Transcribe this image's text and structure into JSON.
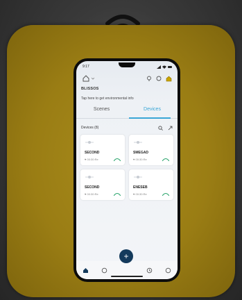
{
  "status_bar": {
    "time": "9:17"
  },
  "header": {
    "home_name": "BLISSOS",
    "env_hint": "Tap here to get environmental info"
  },
  "tabs": [
    {
      "label": "Scenes",
      "active": false
    },
    {
      "label": "Devices",
      "active": true
    }
  ],
  "devices_section": {
    "label": "Devices (8)"
  },
  "cards": [
    {
      "name": "SECOND",
      "sub": "♥ 00:30:Re"
    },
    {
      "name": "SMEGAD",
      "sub": "♥ 00:30:Re"
    },
    {
      "name": "SECOND",
      "sub": "♥ 00:30:Re"
    },
    {
      "name": "ENESEB",
      "sub": "♥ 00:30:Re"
    }
  ],
  "fab": {
    "label": "+"
  },
  "colors": {
    "accent": "#3aa6d6",
    "tile": "#9a7d14",
    "fab": "#143a5c"
  },
  "icons": {
    "wifi": "wifi-icon",
    "home": "home-icon",
    "cloud": "cloud-icon",
    "bulb": "bulb-icon",
    "search": "search-icon",
    "sort": "sort-icon",
    "nav_home": "nav-home-icon",
    "nav_scenes": "nav-scenes-icon",
    "nav_automation": "nav-automation-icon",
    "nav_profile": "nav-profile-icon"
  }
}
